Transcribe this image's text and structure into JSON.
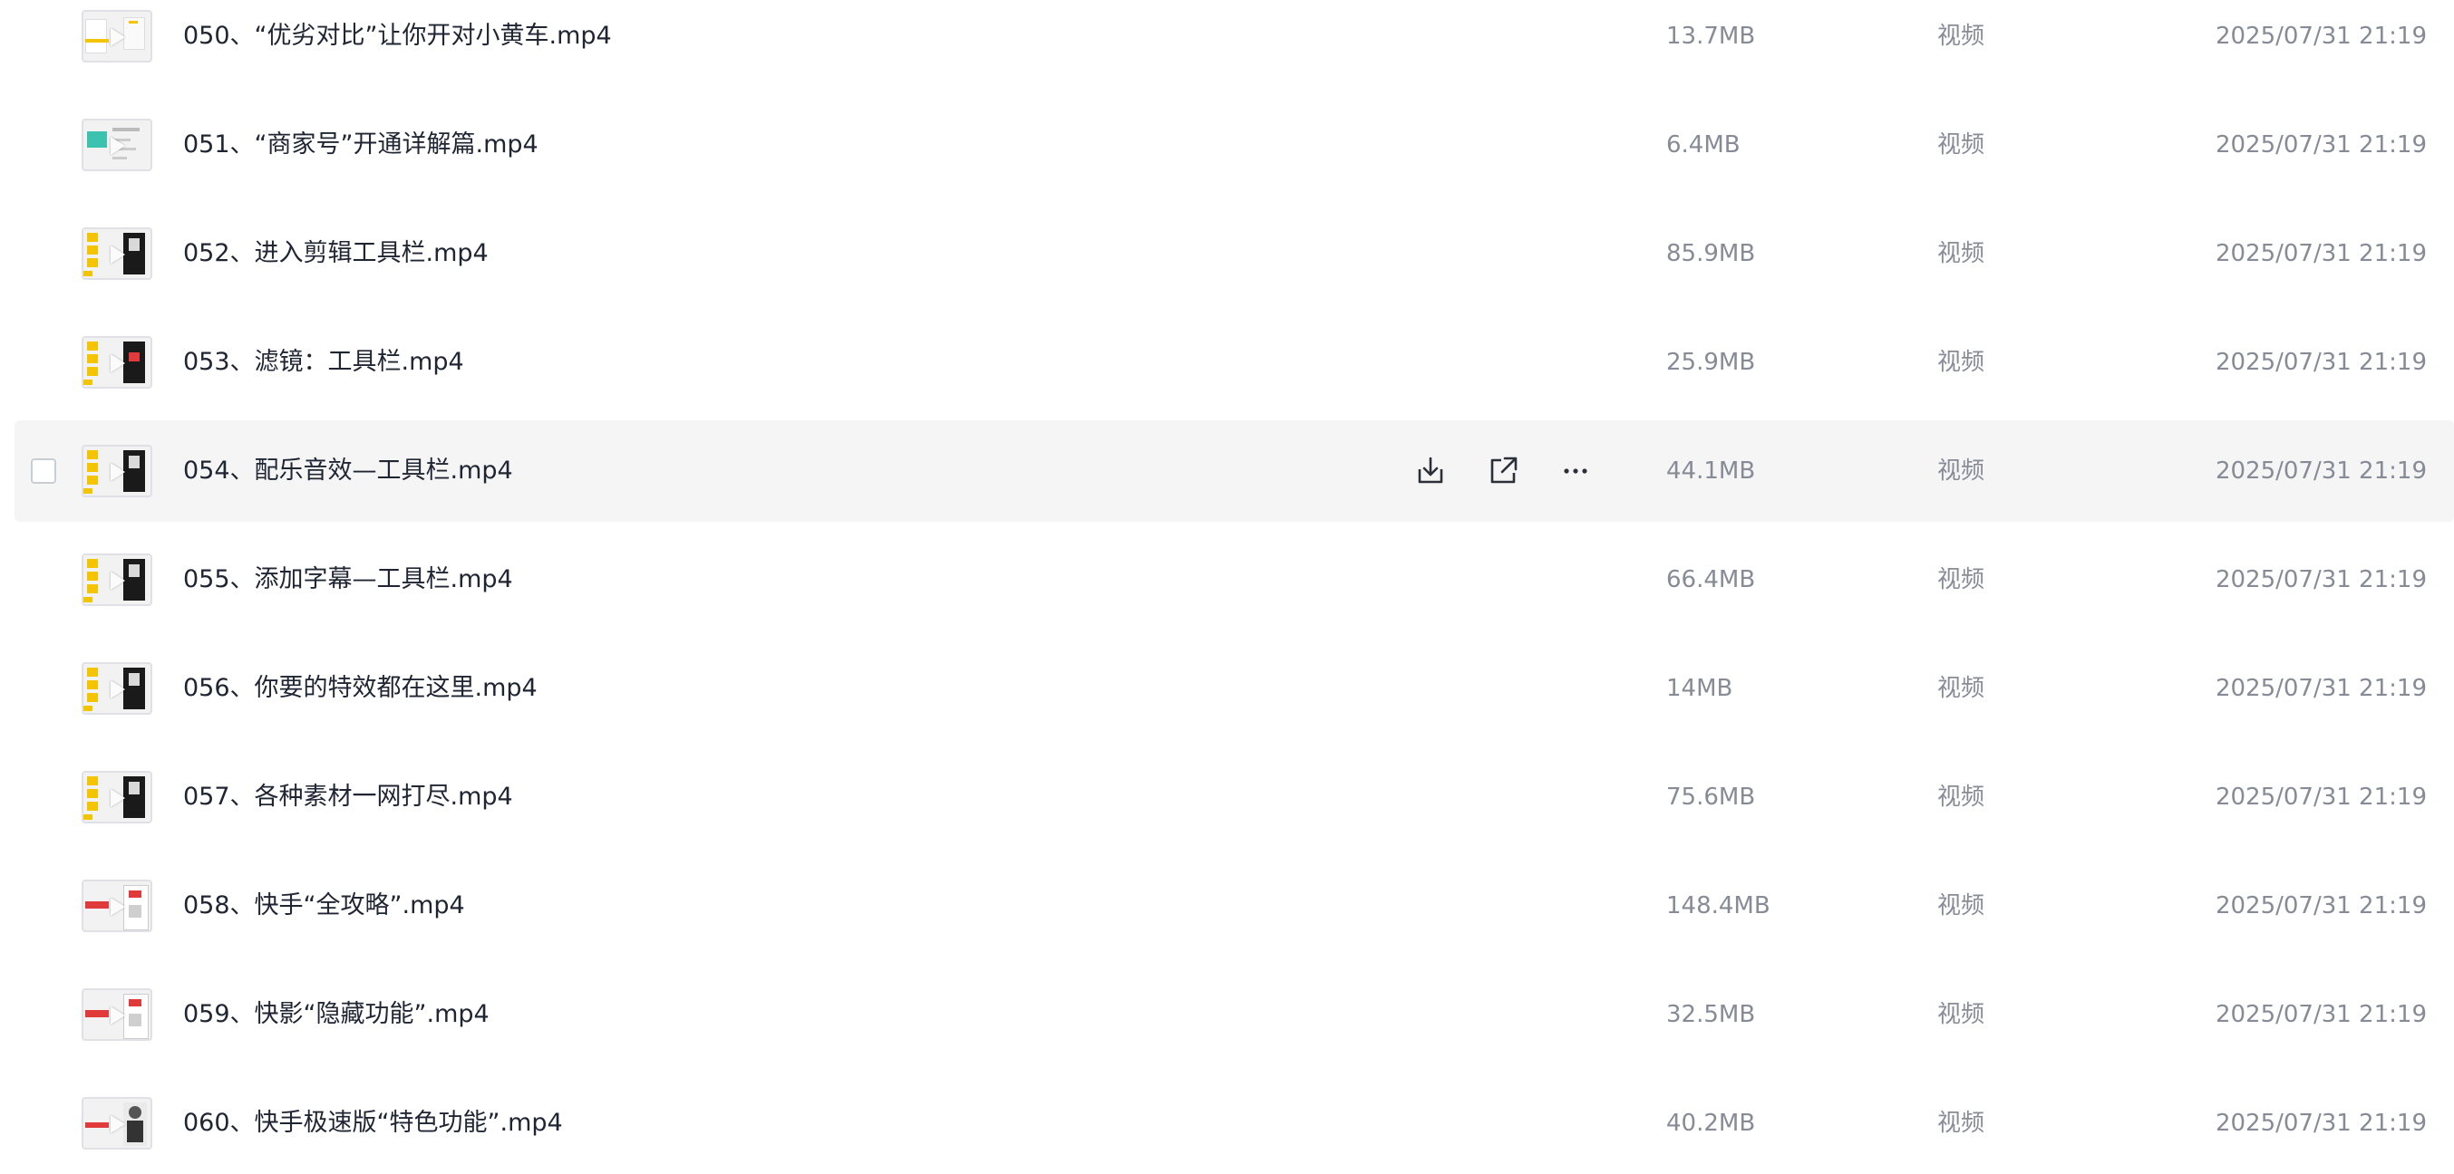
{
  "files": [
    {
      "name": "050、“优劣对比”让你开对小黄车.mp4",
      "size": "13.7MB",
      "type": "视频",
      "time": "2025/07/31 21:19",
      "thumb": "yellow-left"
    },
    {
      "name": "051、“商家号”开通详解篇.mp4",
      "size": "6.4MB",
      "type": "视频",
      "time": "2025/07/31 21:19",
      "thumb": "teal"
    },
    {
      "name": "052、进入剪辑工具栏.mp4",
      "size": "85.9MB",
      "type": "视频",
      "time": "2025/07/31 21:19",
      "thumb": "yellow-phone"
    },
    {
      "name": "053、滤镜：工具栏.mp4",
      "size": "25.9MB",
      "type": "视频",
      "time": "2025/07/31 21:19",
      "thumb": "yellow-phone-red"
    },
    {
      "name": "054、配乐音效—工具栏.mp4",
      "size": "44.1MB",
      "type": "视频",
      "time": "2025/07/31 21:19",
      "thumb": "yellow-phone",
      "hovered": true
    },
    {
      "name": "055、添加字幕—工具栏.mp4",
      "size": "66.4MB",
      "type": "视频",
      "time": "2025/07/31 21:19",
      "thumb": "yellow-phone"
    },
    {
      "name": "056、你要的特效都在这里.mp4",
      "size": "14MB",
      "type": "视频",
      "time": "2025/07/31 21:19",
      "thumb": "yellow-phone"
    },
    {
      "name": "057、各种素材一网打尽.mp4",
      "size": "75.6MB",
      "type": "视频",
      "time": "2025/07/31 21:19",
      "thumb": "yellow-phone"
    },
    {
      "name": "058、快手“全攻略”.mp4",
      "size": "148.4MB",
      "type": "视频",
      "time": "2025/07/31 21:19",
      "thumb": "red-phone"
    },
    {
      "name": "059、快影“隐藏功能”.mp4",
      "size": "32.5MB",
      "type": "视频",
      "time": "2025/07/31 21:19",
      "thumb": "red-phone"
    },
    {
      "name": "060、快手极速版“特色功能”.mp4",
      "size": "40.2MB",
      "type": "视频",
      "time": "2025/07/31 21:19",
      "thumb": "red-person"
    }
  ],
  "hover_actions": [
    {
      "name": "download-icon"
    },
    {
      "name": "share-icon"
    },
    {
      "name": "more-icon"
    }
  ],
  "colors": {
    "text_primary": "#1f2533",
    "text_secondary": "#868b96",
    "hover_bg": "#f5f5f6",
    "thumb_yellow": "#f5c400",
    "thumb_teal": "#3cc3b0",
    "thumb_red": "#e03a3a"
  }
}
